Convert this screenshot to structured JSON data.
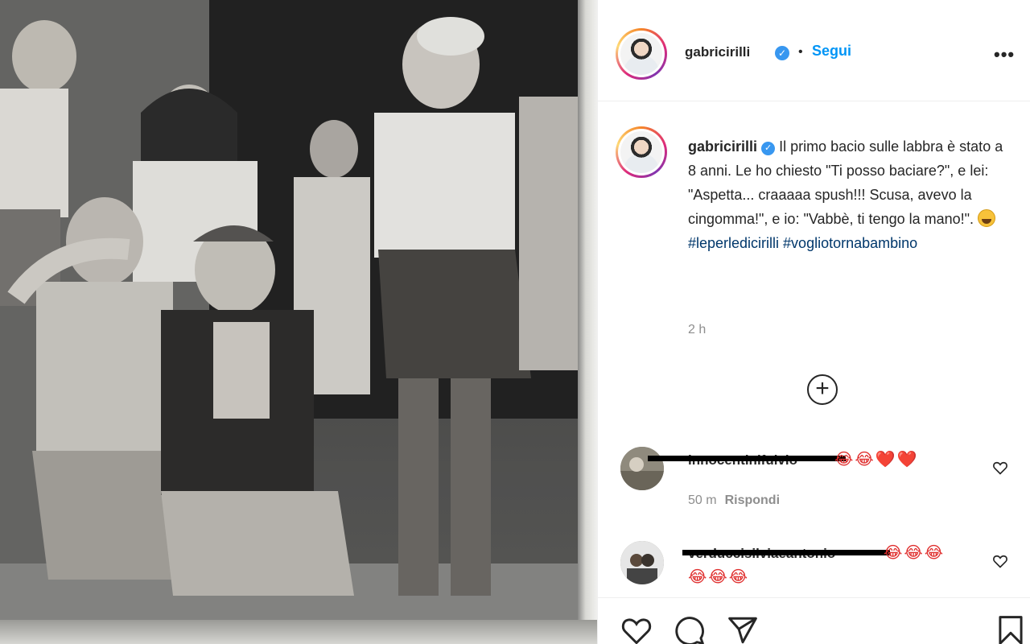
{
  "post": {
    "username": "gabricirilli",
    "verified_mark": "✓",
    "separator": "•",
    "follow_label": "Segui",
    "more_label": "•••",
    "caption_text": "Il primo bacio sulle labbra è stato a 8 anni. Le ho chiesto \"Ti posso baciare?\", e lei: \"Aspetta... craaaaa spush!!! Scusa, avevo la cingomma!\", e io: \"Vabbè, ti tengo la mano!\".",
    "hashtags": "#leperledicirilli #vogliotornabambino",
    "time": "2 h",
    "load_more_label": "+"
  },
  "comments": [
    {
      "username": "innocentinifulvio",
      "emojis": "😂😂❤️❤️",
      "time": "50 m",
      "reply_label": "Rispondi"
    },
    {
      "username": "verduccisilviaeantonio",
      "emojis": "😂😂😂",
      "emojis_line2": "😂😂😂"
    }
  ],
  "icons": {
    "like": "heart-icon",
    "comment": "comment-icon",
    "share": "send-icon",
    "save": "bookmark-icon"
  },
  "colors": {
    "link_blue": "#0095f6",
    "hashtag": "#00376b",
    "verified": "#3897f0",
    "muted": "#8e8e8e"
  }
}
